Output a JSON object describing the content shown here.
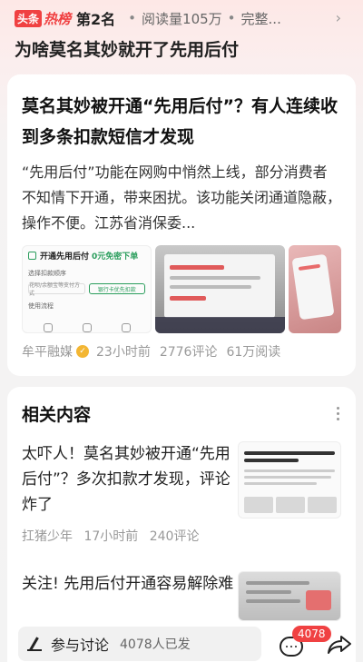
{
  "topbar": {
    "logo_box": "头条",
    "logo_hot": "热榜",
    "rank": "第2名",
    "reads": "阅读量105万",
    "more": "完整..."
  },
  "hot_title": "为啥莫名其妙就开了先用后付",
  "article": {
    "headline": "莫名其妙被开通“先用后付”？有人连续收到多条扣款短信才发现",
    "summary": "“先用后付”功能在网购中悄然上线，部分消费者不知情下开通，带来困扰。该功能关闭通道隐蔽，操作不便。江苏省消保委...",
    "thumb1": {
      "title": "开通先用后付",
      "promo": "0元免密下单",
      "row1": "选择扣款顺序",
      "btn1": "花呗/余额宝等支付方式",
      "btn2": "银行卡优先扣款",
      "row2": "使用流程"
    },
    "source": "牟平融媒",
    "time": "23小时前",
    "comments": "2776评论",
    "reads": "61万阅读"
  },
  "related": {
    "title": "相关内容",
    "items": [
      {
        "text": "太吓人！莫名其妙被开通“先用后付”？多次扣款才发现，评论炸了",
        "source": "扛猪少年",
        "time": "17小时前",
        "comments": "240评论"
      },
      {
        "text": "关注! 先用后付开通容易解除难"
      }
    ]
  },
  "bottom": {
    "discuss_label": "参与讨论",
    "discuss_count": "4078人已发",
    "comment_badge": "4078"
  },
  "colors": {
    "brand_red": "#f04142",
    "verify_gold": "#f3b633",
    "promo_green": "#2a9d5c"
  },
  "icons": [
    "chevron-right-icon",
    "verified-icon",
    "more-icon",
    "pen-icon",
    "comment-icon",
    "share-icon"
  ]
}
